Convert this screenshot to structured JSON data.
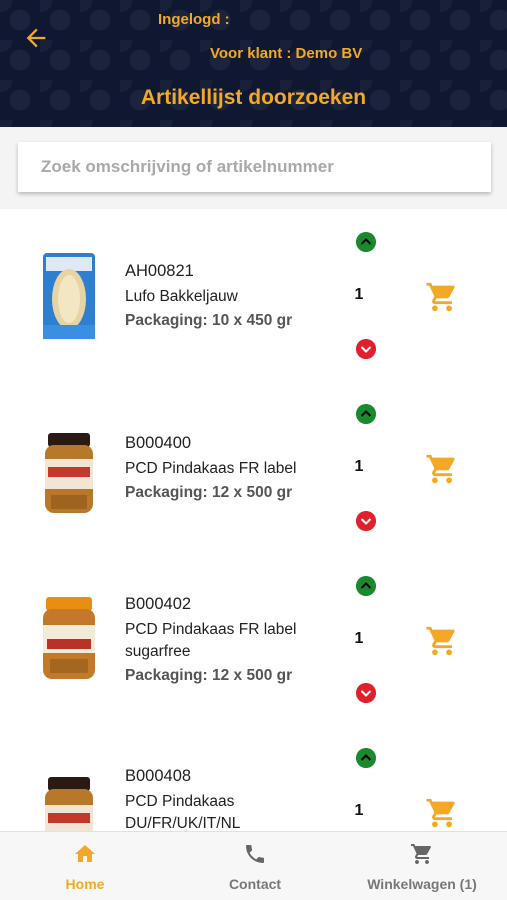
{
  "header": {
    "logged_in_label": "Ingelogd :",
    "customer_label": "Voor klant : Demo BV",
    "title": "Artikellijst doorzoeken"
  },
  "search": {
    "placeholder": "Zoek omschrijving of artikelnummer",
    "value": ""
  },
  "products": [
    {
      "code": "AH00821",
      "name": "Lufo Bakkeljauw",
      "packaging": "Packaging: 10 x 450 gr",
      "quantity": "1",
      "image": "fish-bag-image"
    },
    {
      "code": "B000400",
      "name": "PCD Pindakaas FR label",
      "packaging": "Packaging: 12 x 500 gr",
      "quantity": "1",
      "image": "peanut-butter-jar-image"
    },
    {
      "code": "B000402",
      "name": "PCD Pindakaas FR label sugarfree",
      "packaging": "Packaging: 12 x 500 gr",
      "quantity": "1",
      "image": "peanut-butter-jar-orange-image"
    },
    {
      "code": "B000408",
      "name": "PCD Pindakaas DU/FR/UK/IT/NL",
      "packaging": "",
      "quantity": "1",
      "image": "peanut-butter-jar-image"
    }
  ],
  "bottom_nav": {
    "home": "Home",
    "contact": "Contact",
    "cart": "Winkelwagen (1)"
  },
  "colors": {
    "accent": "#f3a927",
    "header_bg": "#0f1830",
    "increase": "#1b8a2e",
    "decrease": "#e0212d"
  },
  "icons": [
    "back-arrow-icon",
    "chevron-up-icon",
    "chevron-down-icon",
    "cart-icon",
    "home-icon",
    "phone-icon"
  ]
}
